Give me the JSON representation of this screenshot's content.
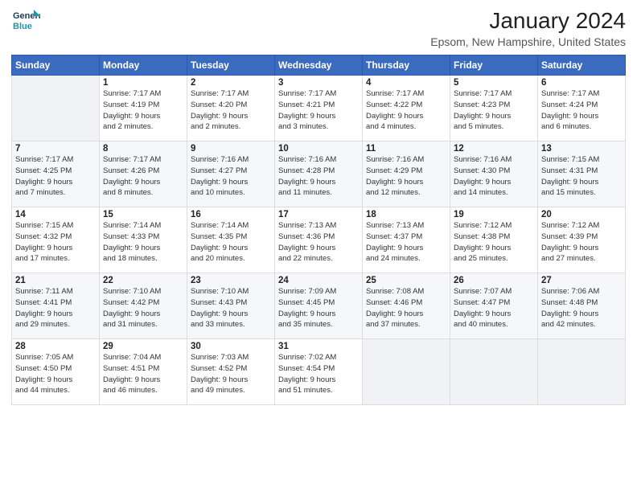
{
  "header": {
    "logo_line1": "General",
    "logo_line2": "Blue",
    "title": "January 2024",
    "subtitle": "Epsom, New Hampshire, United States"
  },
  "days_of_week": [
    "Sunday",
    "Monday",
    "Tuesday",
    "Wednesday",
    "Thursday",
    "Friday",
    "Saturday"
  ],
  "weeks": [
    [
      {
        "day": "",
        "info": ""
      },
      {
        "day": "1",
        "info": "Sunrise: 7:17 AM\nSunset: 4:19 PM\nDaylight: 9 hours\nand 2 minutes."
      },
      {
        "day": "2",
        "info": "Sunrise: 7:17 AM\nSunset: 4:20 PM\nDaylight: 9 hours\nand 2 minutes."
      },
      {
        "day": "3",
        "info": "Sunrise: 7:17 AM\nSunset: 4:21 PM\nDaylight: 9 hours\nand 3 minutes."
      },
      {
        "day": "4",
        "info": "Sunrise: 7:17 AM\nSunset: 4:22 PM\nDaylight: 9 hours\nand 4 minutes."
      },
      {
        "day": "5",
        "info": "Sunrise: 7:17 AM\nSunset: 4:23 PM\nDaylight: 9 hours\nand 5 minutes."
      },
      {
        "day": "6",
        "info": "Sunrise: 7:17 AM\nSunset: 4:24 PM\nDaylight: 9 hours\nand 6 minutes."
      }
    ],
    [
      {
        "day": "7",
        "info": "Sunrise: 7:17 AM\nSunset: 4:25 PM\nDaylight: 9 hours\nand 7 minutes."
      },
      {
        "day": "8",
        "info": "Sunrise: 7:17 AM\nSunset: 4:26 PM\nDaylight: 9 hours\nand 8 minutes."
      },
      {
        "day": "9",
        "info": "Sunrise: 7:16 AM\nSunset: 4:27 PM\nDaylight: 9 hours\nand 10 minutes."
      },
      {
        "day": "10",
        "info": "Sunrise: 7:16 AM\nSunset: 4:28 PM\nDaylight: 9 hours\nand 11 minutes."
      },
      {
        "day": "11",
        "info": "Sunrise: 7:16 AM\nSunset: 4:29 PM\nDaylight: 9 hours\nand 12 minutes."
      },
      {
        "day": "12",
        "info": "Sunrise: 7:16 AM\nSunset: 4:30 PM\nDaylight: 9 hours\nand 14 minutes."
      },
      {
        "day": "13",
        "info": "Sunrise: 7:15 AM\nSunset: 4:31 PM\nDaylight: 9 hours\nand 15 minutes."
      }
    ],
    [
      {
        "day": "14",
        "info": "Sunrise: 7:15 AM\nSunset: 4:32 PM\nDaylight: 9 hours\nand 17 minutes."
      },
      {
        "day": "15",
        "info": "Sunrise: 7:14 AM\nSunset: 4:33 PM\nDaylight: 9 hours\nand 18 minutes."
      },
      {
        "day": "16",
        "info": "Sunrise: 7:14 AM\nSunset: 4:35 PM\nDaylight: 9 hours\nand 20 minutes."
      },
      {
        "day": "17",
        "info": "Sunrise: 7:13 AM\nSunset: 4:36 PM\nDaylight: 9 hours\nand 22 minutes."
      },
      {
        "day": "18",
        "info": "Sunrise: 7:13 AM\nSunset: 4:37 PM\nDaylight: 9 hours\nand 24 minutes."
      },
      {
        "day": "19",
        "info": "Sunrise: 7:12 AM\nSunset: 4:38 PM\nDaylight: 9 hours\nand 25 minutes."
      },
      {
        "day": "20",
        "info": "Sunrise: 7:12 AM\nSunset: 4:39 PM\nDaylight: 9 hours\nand 27 minutes."
      }
    ],
    [
      {
        "day": "21",
        "info": "Sunrise: 7:11 AM\nSunset: 4:41 PM\nDaylight: 9 hours\nand 29 minutes."
      },
      {
        "day": "22",
        "info": "Sunrise: 7:10 AM\nSunset: 4:42 PM\nDaylight: 9 hours\nand 31 minutes."
      },
      {
        "day": "23",
        "info": "Sunrise: 7:10 AM\nSunset: 4:43 PM\nDaylight: 9 hours\nand 33 minutes."
      },
      {
        "day": "24",
        "info": "Sunrise: 7:09 AM\nSunset: 4:45 PM\nDaylight: 9 hours\nand 35 minutes."
      },
      {
        "day": "25",
        "info": "Sunrise: 7:08 AM\nSunset: 4:46 PM\nDaylight: 9 hours\nand 37 minutes."
      },
      {
        "day": "26",
        "info": "Sunrise: 7:07 AM\nSunset: 4:47 PM\nDaylight: 9 hours\nand 40 minutes."
      },
      {
        "day": "27",
        "info": "Sunrise: 7:06 AM\nSunset: 4:48 PM\nDaylight: 9 hours\nand 42 minutes."
      }
    ],
    [
      {
        "day": "28",
        "info": "Sunrise: 7:05 AM\nSunset: 4:50 PM\nDaylight: 9 hours\nand 44 minutes."
      },
      {
        "day": "29",
        "info": "Sunrise: 7:04 AM\nSunset: 4:51 PM\nDaylight: 9 hours\nand 46 minutes."
      },
      {
        "day": "30",
        "info": "Sunrise: 7:03 AM\nSunset: 4:52 PM\nDaylight: 9 hours\nand 49 minutes."
      },
      {
        "day": "31",
        "info": "Sunrise: 7:02 AM\nSunset: 4:54 PM\nDaylight: 9 hours\nand 51 minutes."
      },
      {
        "day": "",
        "info": ""
      },
      {
        "day": "",
        "info": ""
      },
      {
        "day": "",
        "info": ""
      }
    ]
  ]
}
